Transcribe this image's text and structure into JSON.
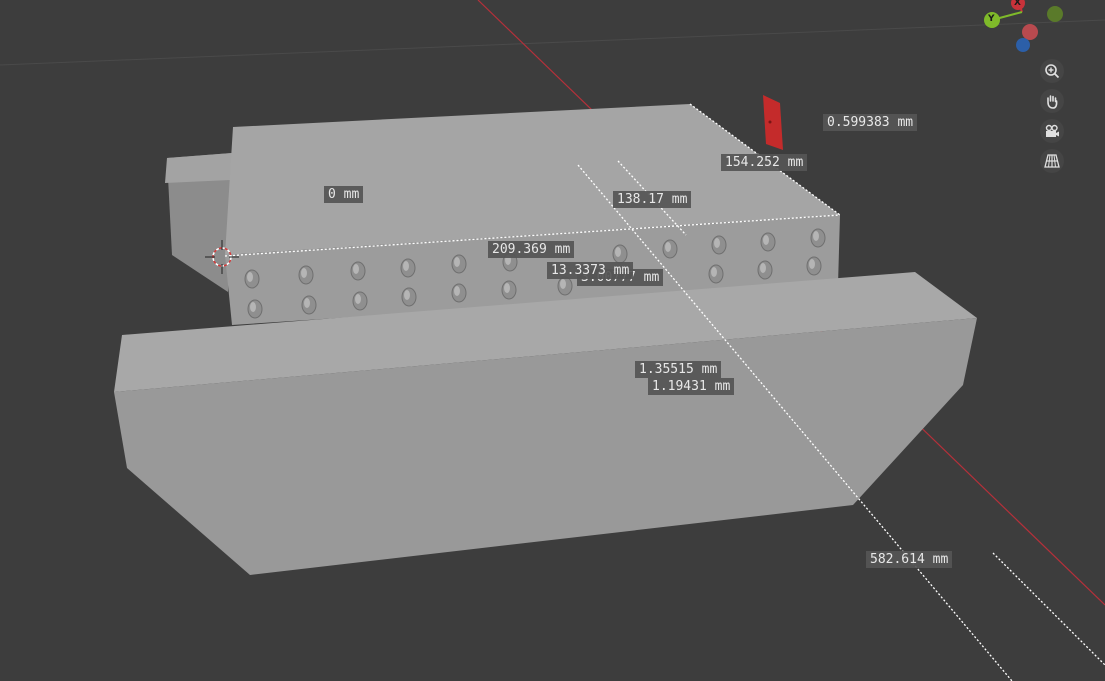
{
  "viewport": {
    "background_color": "#3d3d3d",
    "model_color": "#a0a0a0",
    "x_axis_color": "#c8323a",
    "y_axis_color": "#7fba2a",
    "z_axis_color": "#2c6fc9"
  },
  "gizmo": {
    "x_label": "X",
    "y_label": "Y"
  },
  "navigation": {
    "zoom_icon": "zoom-in-icon",
    "pan_icon": "hand-icon",
    "camera_icon": "camera-icon",
    "ortho_icon": "grid-perspective-icon"
  },
  "measurements": {
    "m1": "0 mm",
    "m2": "154.252 mm",
    "m3": "138.17 mm",
    "m4": "209.369 mm",
    "m5": "13.3373 mm",
    "m6": "3.00777 mm",
    "m7": "1.35515 mm",
    "m8": "1.19431 mm",
    "m9": "582.614 mm",
    "m10": "0.599383 mm"
  }
}
